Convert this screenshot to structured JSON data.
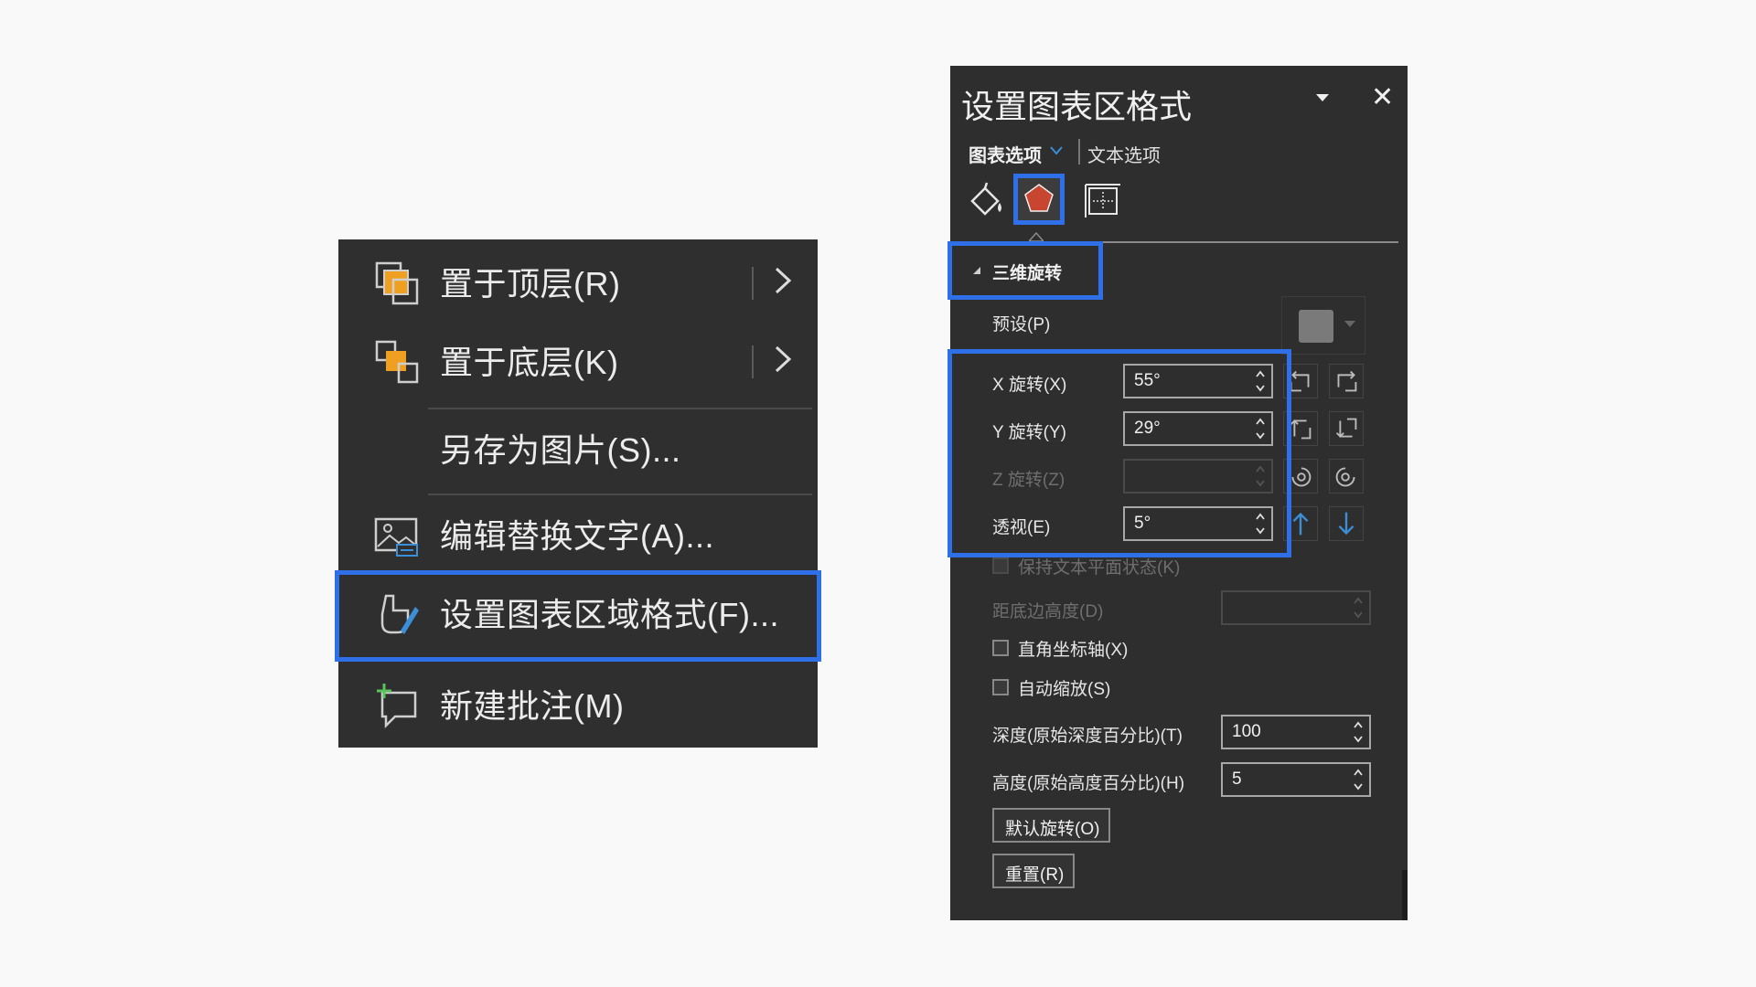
{
  "context_menu": {
    "items": [
      {
        "label": "置于顶层(R)",
        "icon": "bring-to-front-icon",
        "submenu": true
      },
      {
        "label": "置于底层(K)",
        "icon": "send-to-back-icon",
        "submenu": true
      },
      {
        "label": "另存为图片(S)...",
        "icon": "",
        "submenu": false
      },
      {
        "label": "编辑替换文字(A)...",
        "icon": "alt-text-icon",
        "submenu": false
      },
      {
        "label": "设置图表区域格式(F)...",
        "icon": "format-chart-icon",
        "submenu": false,
        "highlighted": true
      },
      {
        "label": "新建批注(M)",
        "icon": "new-comment-icon",
        "submenu": false
      }
    ]
  },
  "format_pane": {
    "title": "设置图表区格式",
    "tabs": {
      "chart_options": "图表选项",
      "text_options": "文本选项"
    },
    "category_icons": [
      "fill-line-icon",
      "effects-pentagon-icon",
      "size-properties-icon"
    ],
    "section": {
      "title": "三维旋转",
      "expanded": true
    },
    "preset_label": "预设(P)",
    "x_rotation": {
      "label": "X 旋转(X)",
      "value": "55°"
    },
    "y_rotation": {
      "label": "Y 旋转(Y)",
      "value": "29°"
    },
    "z_rotation": {
      "label": "Z 旋转(Z)",
      "value": "",
      "disabled": true
    },
    "perspective": {
      "label": "透视(E)",
      "value": "5°"
    },
    "keep_text_flat": {
      "label": "保持文本平面状态(K)",
      "disabled": true
    },
    "distance_from_ground": {
      "label": "距底边高度(D)",
      "value": "",
      "disabled": true
    },
    "right_angle_axes": {
      "label": "直角坐标轴(X)",
      "checked": false
    },
    "autoscale": {
      "label": "自动缩放(S)",
      "checked": false
    },
    "depth": {
      "label": "深度(原始深度百分比)(T)",
      "value": "100"
    },
    "height": {
      "label": "高度(原始高度百分比)(H)",
      "value": "5"
    },
    "default_rotation_button": "默认旋转(O)",
    "reset_button": "重置(R)"
  },
  "colors": {
    "highlight": "#2f6fe8",
    "menu_bg": "#2f2f2f",
    "pane_bg": "#2e2e2e",
    "accent_blue": "#3a8fd8",
    "pentagon": "#c8452f"
  }
}
